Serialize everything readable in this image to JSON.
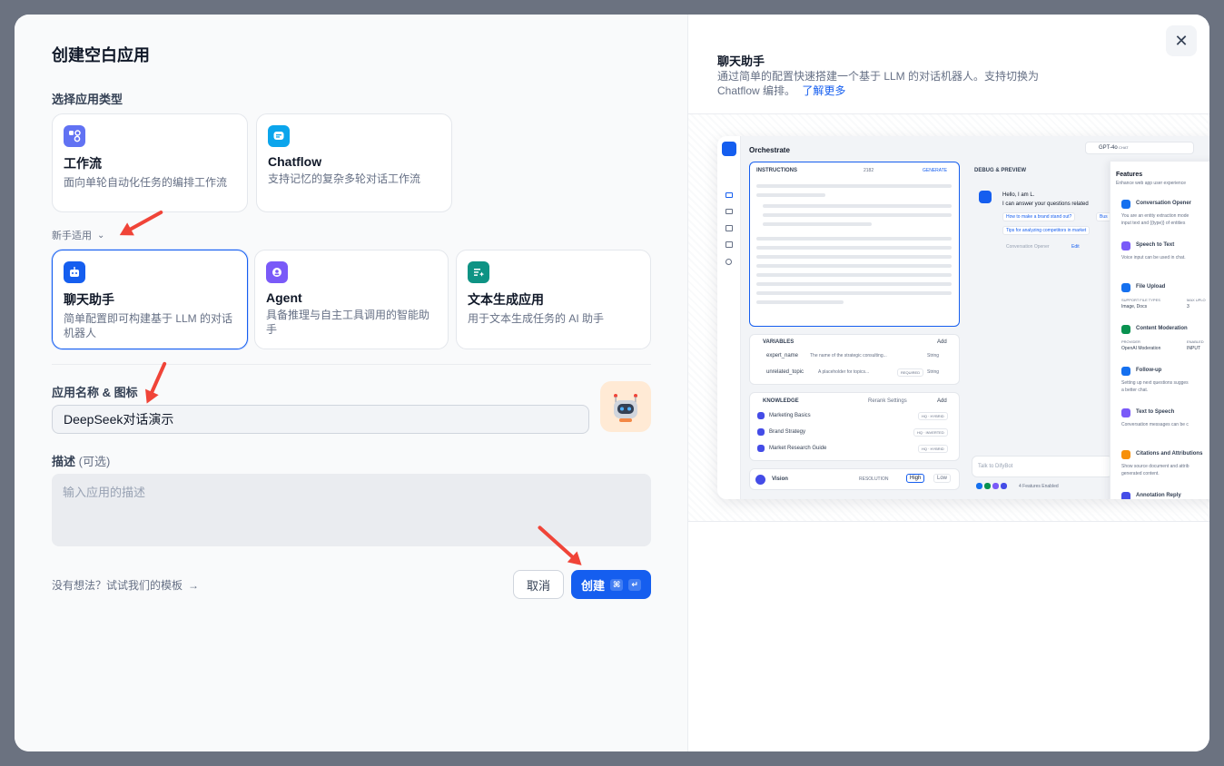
{
  "dialog": {
    "title": "创建空白应用",
    "type_label": "选择应用类型",
    "beginner_toggle": "新手适用",
    "types_top": [
      {
        "title": "工作流",
        "desc": "面向单轮自动化任务的编排工作流",
        "color": "#6172f3"
      },
      {
        "title": "Chatflow",
        "desc": "支持记忆的复杂多轮对话工作流",
        "color": "#0ba5ec"
      }
    ],
    "types_beginner": [
      {
        "title": "聊天助手",
        "desc": "简单配置即可构建基于 LLM 的对话机器人",
        "color": "#155eef"
      },
      {
        "title": "Agent",
        "desc": "具备推理与自主工具调用的智能助手",
        "color": "#7a5af8"
      },
      {
        "title": "文本生成应用",
        "desc": "用于文本生成任务的 AI 助手",
        "color": "#0e9384"
      }
    ],
    "name_label": "应用名称 & 图标",
    "name_value": "DeepSeek对话演示",
    "desc_label": "描述",
    "desc_optional": "(可选)",
    "desc_placeholder": "输入应用的描述",
    "template_link": "没有想法？试试我们的模板",
    "cancel": "取消",
    "create": "创建",
    "create_kbd": [
      "⌘",
      "↵"
    ]
  },
  "preview": {
    "title": "聊天助手",
    "desc": "通过简单的配置快速搭建一个基于 LLM 的对话机器人。支持切换为 Chatflow 编排。",
    "learn_more": "了解更多",
    "app": {
      "header": "Orchestrate",
      "model": "GPT-4o",
      "model_badge": "CHAT",
      "instructions": "INSTRUCTIONS",
      "token_count": "2182",
      "generate": "GENERATE",
      "variables": "VARIABLES",
      "add": "Add",
      "vars": [
        {
          "key": "expert_name",
          "desc": "The name of the strategic consulting...",
          "type": "String"
        },
        {
          "key": "unrelated_topic",
          "desc": "A placeholder for topics...",
          "req": "REQUIRED",
          "type": "String"
        }
      ],
      "knowledge": "KNOWLEDGE",
      "rerank": "Rerank Settings",
      "kb": [
        {
          "name": "Marketing Basics",
          "tag": "HQ · HYBRID"
        },
        {
          "name": "Brand Strategy",
          "tag": "HQ · INVERTED"
        },
        {
          "name": "Market Research Guide",
          "tag": "HQ · HYBRID"
        }
      ],
      "vision": "Vision",
      "resolution": "RESOLUTION",
      "high": "High",
      "low": "Low",
      "debug": "DEBUG & PREVIEW",
      "hello": "Hello, I am L.",
      "hello2": "I can answer your questions related",
      "q1": "How to make a brand stand out?",
      "q1b": "Bus",
      "q2": "Tips for analyzing competitors in market",
      "opener": "Conversation Opener",
      "edit": "Edit",
      "talk": "Talk to DifyBot",
      "enabled": "4 Features Enabled",
      "features": "Features",
      "features_sub": "Enhance web app user experience",
      "feat": [
        {
          "name": "Conversation Opener",
          "desc": "You are an entity extraction mode",
          "desc2": "input text and {{type}} of entities",
          "color": "#1570ef"
        },
        {
          "name": "Speech to Text",
          "desc": "Voice input can be used in chat.",
          "color": "#7a5af8"
        },
        {
          "name": "File Upload",
          "desc": "SUPPORT FILE TYPES",
          "desc2": "Image, Docs",
          "extra": "MAX UPLO",
          "extra2": "3",
          "color": "#1570ef"
        },
        {
          "name": "Content Moderation",
          "desc": "PROVIDER",
          "desc2": "OpenAI Moderation",
          "extra": "ENABLED",
          "extra2": "INPUT",
          "color": "#099250"
        },
        {
          "name": "Follow-up",
          "desc": "Setting up next questions sugges",
          "desc2": "a better chat.",
          "color": "#1570ef"
        },
        {
          "name": "Text to Speech",
          "desc": "Conversation messages can be c",
          "color": "#7a5af8"
        },
        {
          "name": "Citations and Attributions",
          "desc": "Show source document and attrib",
          "desc2": "generated content.",
          "color": "#f79009"
        },
        {
          "name": "Annotation Reply",
          "color": "#444ce7"
        }
      ]
    }
  }
}
